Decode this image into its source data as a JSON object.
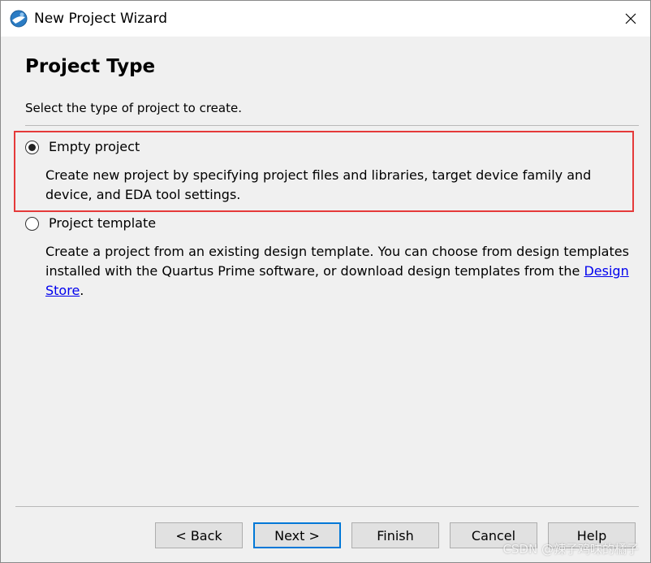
{
  "window": {
    "title": "New Project Wizard"
  },
  "page": {
    "title": "Project Type",
    "instructions": "Select the type of project to create."
  },
  "options": [
    {
      "label": "Empty project",
      "selected": true,
      "description": "Create new project by specifying project files and libraries, target device family and device, and EDA tool settings."
    },
    {
      "label": "Project template",
      "selected": false,
      "description_prefix": "Create a project from an existing design template. You can choose from design templates installed with the Quartus Prime software, or download design templates from the ",
      "link_text": "Design Store",
      "description_suffix": "."
    }
  ],
  "buttons": {
    "back": "< Back",
    "next": "Next >",
    "finish": "Finish",
    "cancel": "Cancel",
    "help": "Help"
  },
  "watermark": "CSDN @辣子鸡味的橘子",
  "colors": {
    "highlight": "#e53a3a",
    "link": "#0000ee",
    "focus": "#0078d7"
  }
}
